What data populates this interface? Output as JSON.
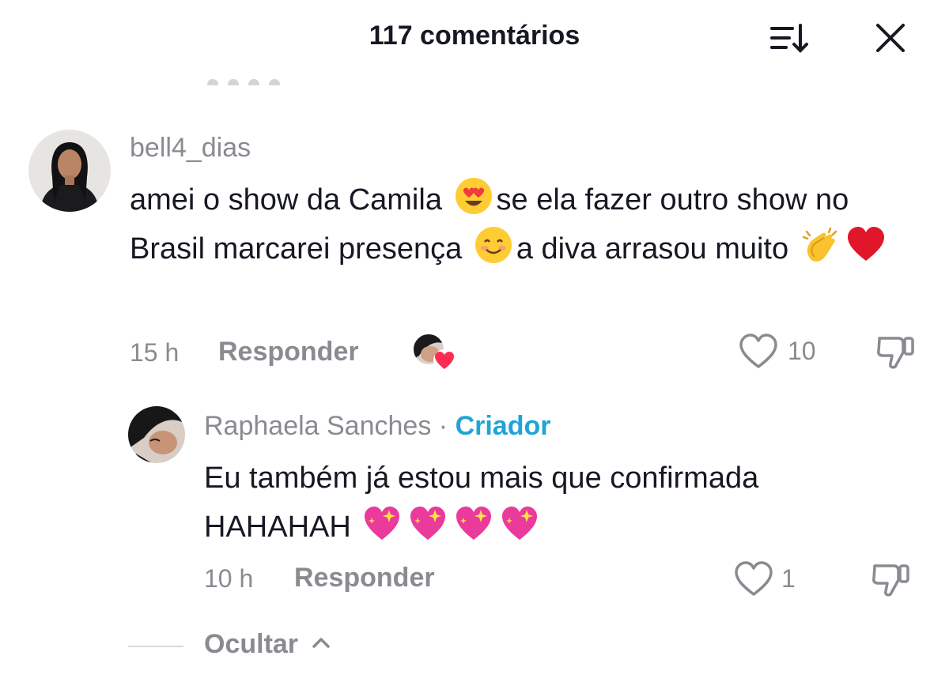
{
  "header": {
    "title": "117 comentários",
    "sort_icon": "sort-icon",
    "close_icon": "close-icon"
  },
  "comments": [
    {
      "username": "bell4_dias",
      "text_parts": [
        "amei o show da Camila",
        "se ela fazer outro show no Brasil marcarei presença",
        "a diva arrasou muito"
      ],
      "emojis": [
        "heart-eyes-emoji",
        "smiling-face-emoji",
        "clapping-hands-emoji",
        "red-heart-emoji"
      ],
      "time": "15 h",
      "reply_label": "Responder",
      "likes": "10",
      "creator_liked": true
    }
  ],
  "replies": [
    {
      "username": "Raphaela Sanches",
      "separator": "·",
      "badge": "Criador",
      "text": "Eu também já estou mais que confirmada HAHAHAH",
      "emojis": [
        "sparkling-heart-emoji",
        "sparkling-heart-emoji",
        "sparkling-heart-emoji",
        "sparkling-heart-emoji"
      ],
      "time": "10 h",
      "reply_label": "Responder",
      "likes": "1"
    }
  ],
  "thread": {
    "hide_label": "Ocultar"
  },
  "colors": {
    "text": "#161823",
    "muted": "#8a8b91",
    "creator_badge": "#20a4d6",
    "like_heart": "#fe2c55"
  }
}
